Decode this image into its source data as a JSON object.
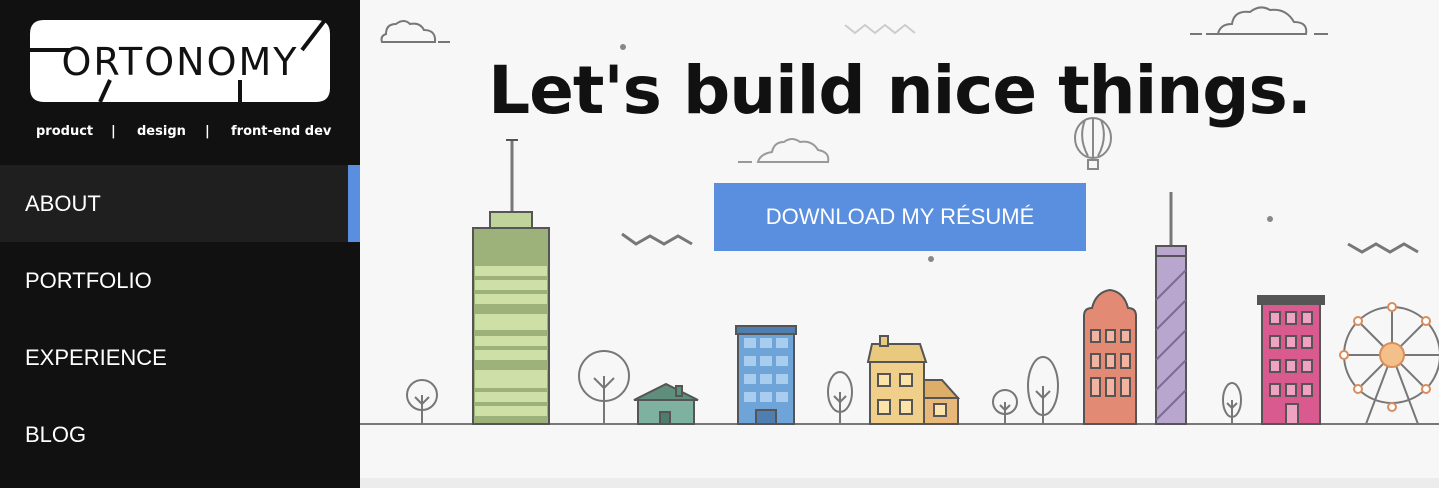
{
  "logo": {
    "text": "ORTONOMY"
  },
  "tagline": {
    "items": [
      "product",
      "design",
      "front-end dev"
    ],
    "separator": "|"
  },
  "nav": {
    "items": [
      {
        "label": "ABOUT",
        "active": true
      },
      {
        "label": "PORTFOLIO",
        "active": false
      },
      {
        "label": "EXPERIENCE",
        "active": false
      },
      {
        "label": "BLOG",
        "active": false
      }
    ]
  },
  "hero": {
    "title": "Let's build nice things.",
    "cta_label": "DOWNLOAD MY RÉSUMÉ"
  },
  "colors": {
    "sidebar_bg": "#111111",
    "accent": "#5a8ede",
    "hero_bg": "#f7f7f7"
  },
  "icons": {
    "illustration": [
      "cloud-icon",
      "balloon-icon",
      "skyscraper-icon",
      "house-icon",
      "tree-icon",
      "ferris-wheel-icon"
    ]
  }
}
